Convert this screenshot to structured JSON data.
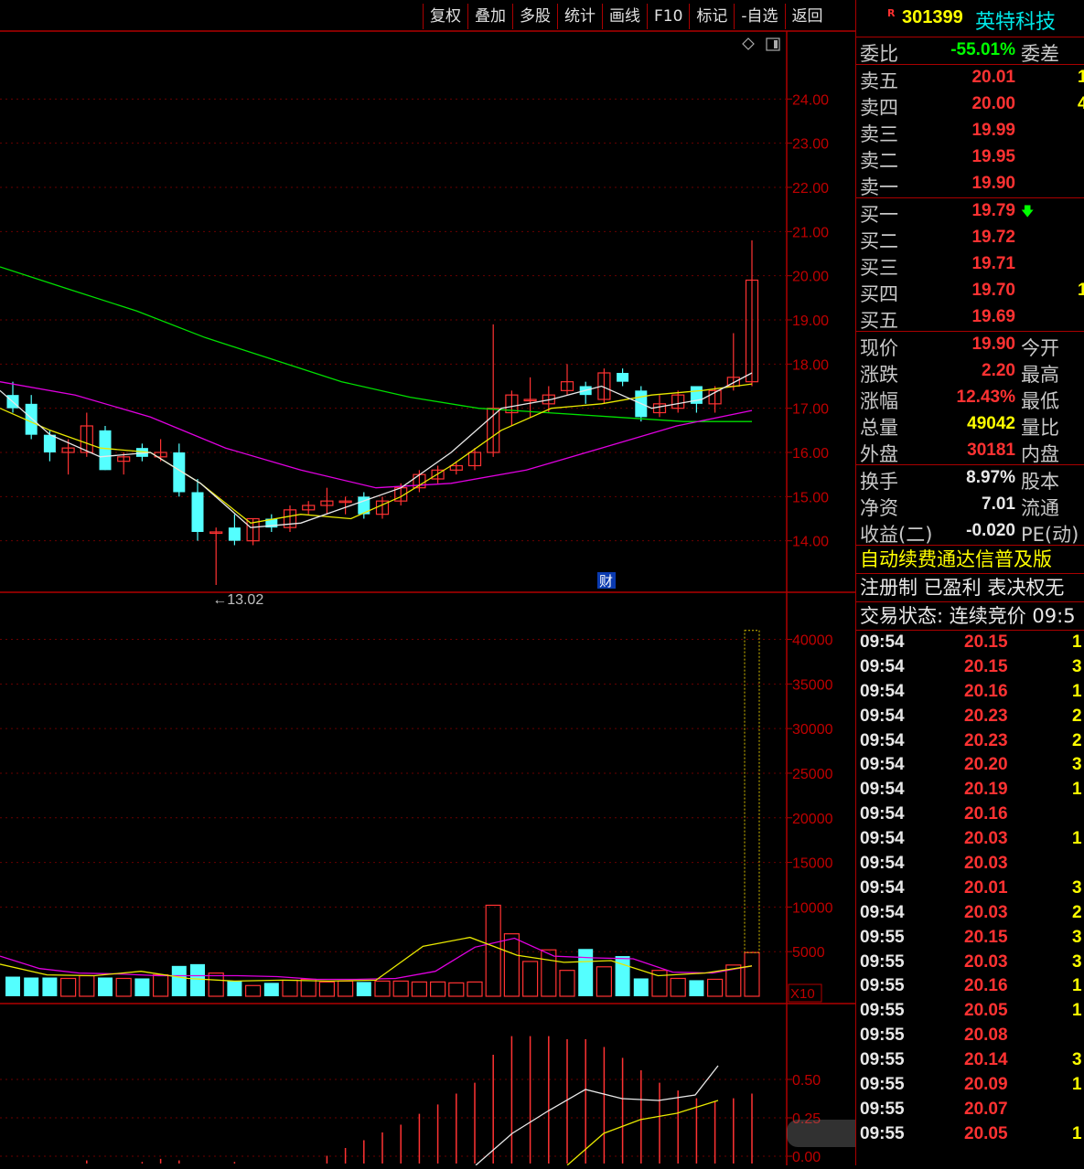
{
  "toolbar": [
    "复权",
    "叠加",
    "多股",
    "统计",
    "画线",
    "F10",
    "标记",
    "-自选",
    "返回"
  ],
  "stock": {
    "badge": "R",
    "code": "301399",
    "name": "英特科技"
  },
  "ratio": {
    "label": "委比",
    "value": "-55.01%",
    "label2": "委差"
  },
  "asks": [
    {
      "label": "卖五",
      "price": "20.01",
      "vol": "1"
    },
    {
      "label": "卖四",
      "price": "20.00",
      "vol": "4"
    },
    {
      "label": "卖三",
      "price": "19.99",
      "vol": ""
    },
    {
      "label": "卖二",
      "price": "19.95",
      "vol": ""
    },
    {
      "label": "卖一",
      "price": "19.90",
      "vol": ""
    }
  ],
  "bids": [
    {
      "label": "买一",
      "price": "19.79",
      "vol": ""
    },
    {
      "label": "买二",
      "price": "19.72",
      "vol": ""
    },
    {
      "label": "买三",
      "price": "19.71",
      "vol": ""
    },
    {
      "label": "买四",
      "price": "19.70",
      "vol": "1"
    },
    {
      "label": "买五",
      "price": "19.69",
      "vol": ""
    }
  ],
  "stats": [
    {
      "label": "现价",
      "value": "19.90",
      "color": "red",
      "label2": "今开"
    },
    {
      "label": "涨跌",
      "value": "2.20",
      "color": "red",
      "label2": "最高"
    },
    {
      "label": "涨幅",
      "value": "12.43%",
      "color": "red",
      "label2": "最低"
    },
    {
      "label": "总量",
      "value": "49042",
      "color": "yellow",
      "label2": "量比"
    },
    {
      "label": "外盘",
      "value": "30181",
      "color": "red",
      "label2": "内盘"
    }
  ],
  "stats2": [
    {
      "label": "换手",
      "value": "8.97%",
      "color": "white",
      "label2": "股本"
    },
    {
      "label": "净资",
      "value": "7.01",
      "color": "white",
      "label2": "流通"
    },
    {
      "label": "收益(二)",
      "value": "-0.020",
      "color": "white",
      "label2": "PE(动)"
    }
  ],
  "banner": "自动续费通达信普及版",
  "tags": "注册制 已盈利 表决权无",
  "trade_status": "交易状态: 连续竞价 09:5",
  "ticks": [
    {
      "t": "09:54",
      "p": "20.15",
      "v": "1"
    },
    {
      "t": "09:54",
      "p": "20.15",
      "v": "3"
    },
    {
      "t": "09:54",
      "p": "20.16",
      "v": "1"
    },
    {
      "t": "09:54",
      "p": "20.23",
      "v": "2"
    },
    {
      "t": "09:54",
      "p": "20.23",
      "v": "2"
    },
    {
      "t": "09:54",
      "p": "20.20",
      "v": "3"
    },
    {
      "t": "09:54",
      "p": "20.19",
      "v": "1"
    },
    {
      "t": "09:54",
      "p": "20.16",
      "v": ""
    },
    {
      "t": "09:54",
      "p": "20.03",
      "v": "1"
    },
    {
      "t": "09:54",
      "p": "20.03",
      "v": ""
    },
    {
      "t": "09:54",
      "p": "20.01",
      "v": "3"
    },
    {
      "t": "09:54",
      "p": "20.03",
      "v": "2"
    },
    {
      "t": "09:55",
      "p": "20.15",
      "v": "3"
    },
    {
      "t": "09:55",
      "p": "20.03",
      "v": "3"
    },
    {
      "t": "09:55",
      "p": "20.16",
      "v": "1"
    },
    {
      "t": "09:55",
      "p": "20.05",
      "v": "1"
    },
    {
      "t": "09:55",
      "p": "20.08",
      "v": ""
    },
    {
      "t": "09:55",
      "p": "20.14",
      "v": "3"
    },
    {
      "t": "09:55",
      "p": "20.09",
      "v": "1"
    },
    {
      "t": "09:55",
      "p": "20.07",
      "v": ""
    },
    {
      "t": "09:55",
      "p": "20.05",
      "v": "1"
    }
  ],
  "chart_data": {
    "type": "candlestick",
    "price_axis": {
      "ticks": [
        "24.00",
        "23.00",
        "22.00",
        "21.00",
        "20.00",
        "19.00",
        "18.00",
        "17.00",
        "16.00",
        "15.00",
        "14.00"
      ],
      "min": 13.0,
      "max": 25.0
    },
    "low_annotation": "←13.02",
    "fin_badge": "财",
    "candles": [
      {
        "o": 17.3,
        "c": 17.0,
        "h": 17.6,
        "l": 16.9
      },
      {
        "o": 17.1,
        "c": 16.4,
        "h": 17.3,
        "l": 16.3
      },
      {
        "o": 16.4,
        "c": 16.0,
        "h": 16.5,
        "l": 15.8
      },
      {
        "o": 16.0,
        "c": 16.1,
        "h": 16.3,
        "l": 15.5
      },
      {
        "o": 16.0,
        "c": 16.6,
        "h": 16.9,
        "l": 15.9
      },
      {
        "o": 16.5,
        "c": 15.6,
        "h": 16.6,
        "l": 15.6
      },
      {
        "o": 15.8,
        "c": 15.9,
        "h": 16.0,
        "l": 15.5
      },
      {
        "o": 16.1,
        "c": 15.9,
        "h": 16.2,
        "l": 15.8
      },
      {
        "o": 15.9,
        "c": 16.0,
        "h": 16.3,
        "l": 15.8
      },
      {
        "o": 16.0,
        "c": 15.1,
        "h": 16.2,
        "l": 15.0
      },
      {
        "o": 15.1,
        "c": 14.2,
        "h": 15.4,
        "l": 14.0
      },
      {
        "o": 14.2,
        "c": 14.2,
        "h": 14.3,
        "l": 13.0
      },
      {
        "o": 14.3,
        "c": 14.0,
        "h": 14.6,
        "l": 13.9
      },
      {
        "o": 14.0,
        "c": 14.5,
        "h": 14.5,
        "l": 13.9
      },
      {
        "o": 14.5,
        "c": 14.3,
        "h": 14.6,
        "l": 14.2
      },
      {
        "o": 14.3,
        "c": 14.7,
        "h": 14.8,
        "l": 14.2
      },
      {
        "o": 14.7,
        "c": 14.8,
        "h": 14.9,
        "l": 14.6
      },
      {
        "o": 14.8,
        "c": 14.9,
        "h": 15.2,
        "l": 14.6
      },
      {
        "o": 14.9,
        "c": 14.9,
        "h": 15.0,
        "l": 14.6
      },
      {
        "o": 15.0,
        "c": 14.6,
        "h": 15.1,
        "l": 14.5
      },
      {
        "o": 14.6,
        "c": 14.9,
        "h": 15.0,
        "l": 14.5
      },
      {
        "o": 14.9,
        "c": 15.2,
        "h": 15.3,
        "l": 14.8
      },
      {
        "o": 15.2,
        "c": 15.5,
        "h": 15.6,
        "l": 15.1
      },
      {
        "o": 15.4,
        "c": 15.6,
        "h": 15.7,
        "l": 15.3
      },
      {
        "o": 15.6,
        "c": 15.7,
        "h": 15.8,
        "l": 15.5
      },
      {
        "o": 15.7,
        "c": 16.0,
        "h": 16.1,
        "l": 15.6
      },
      {
        "o": 16.0,
        "c": 17.0,
        "h": 18.9,
        "l": 15.9
      },
      {
        "o": 16.9,
        "c": 17.3,
        "h": 17.4,
        "l": 16.6
      },
      {
        "o": 17.2,
        "c": 17.2,
        "h": 17.7,
        "l": 16.8
      },
      {
        "o": 17.1,
        "c": 17.3,
        "h": 17.5,
        "l": 16.9
      },
      {
        "o": 17.4,
        "c": 17.6,
        "h": 18.0,
        "l": 17.3
      },
      {
        "o": 17.5,
        "c": 17.3,
        "h": 17.6,
        "l": 17.1
      },
      {
        "o": 17.2,
        "c": 17.8,
        "h": 17.9,
        "l": 17.1
      },
      {
        "o": 17.8,
        "c": 17.6,
        "h": 17.9,
        "l": 17.5
      },
      {
        "o": 17.4,
        "c": 16.8,
        "h": 17.5,
        "l": 16.7
      },
      {
        "o": 16.9,
        "c": 17.1,
        "h": 17.3,
        "l": 16.8
      },
      {
        "o": 17.0,
        "c": 17.3,
        "h": 17.4,
        "l": 16.9
      },
      {
        "o": 17.5,
        "c": 17.1,
        "h": 17.5,
        "l": 16.9
      },
      {
        "o": 17.1,
        "c": 17.4,
        "h": 17.5,
        "l": 16.9
      },
      {
        "o": 17.5,
        "c": 17.7,
        "h": 18.7,
        "l": 17.4
      },
      {
        "o": 17.6,
        "c": 19.9,
        "h": 20.8,
        "l": 17.5
      }
    ],
    "ma_green": [
      20.2,
      19.7,
      19.2,
      18.6,
      18.1,
      17.6,
      17.25,
      17.0,
      16.9,
      16.8,
      16.7,
      16.7
    ],
    "ma_magenta": [
      17.6,
      17.3,
      16.8,
      16.1,
      15.6,
      15.2,
      15.3,
      15.6,
      16.1,
      16.6,
      16.95
    ],
    "ma_yellow": [
      17.0,
      16.5,
      16.1,
      16.0,
      15.3,
      14.4,
      14.6,
      14.5,
      15.0,
      15.7,
      16.5,
      17.0,
      17.1,
      17.3,
      17.4,
      17.55
    ],
    "ma_white": [
      17.4,
      16.4,
      15.9,
      16.0,
      15.3,
      14.3,
      14.4,
      14.8,
      15.2,
      16.0,
      17.0,
      17.2,
      17.5,
      17.0,
      17.2,
      17.8
    ],
    "volume_axis": {
      "ticks": [
        "40000",
        "35000",
        "30000",
        "25000",
        "20000",
        "15000",
        "10000",
        "5000"
      ],
      "max": 42000,
      "unit": "X10"
    },
    "volumes": [
      2200,
      2100,
      2100,
      2000,
      2300,
      2100,
      2000,
      2000,
      2400,
      3400,
      3600,
      2600,
      1700,
      1200,
      1500,
      1800,
      1900,
      1600,
      1700,
      1600,
      1700,
      1700,
      1600,
      1600,
      1500,
      1600,
      10200,
      7000,
      3900,
      5200,
      2900,
      5300,
      3300,
      4500,
      2000,
      2900,
      2000,
      1800,
      1900,
      3500,
      41000
    ],
    "macd_axis": {
      "ticks": [
        "0.50",
        "0.25",
        "0.00"
      ]
    }
  }
}
